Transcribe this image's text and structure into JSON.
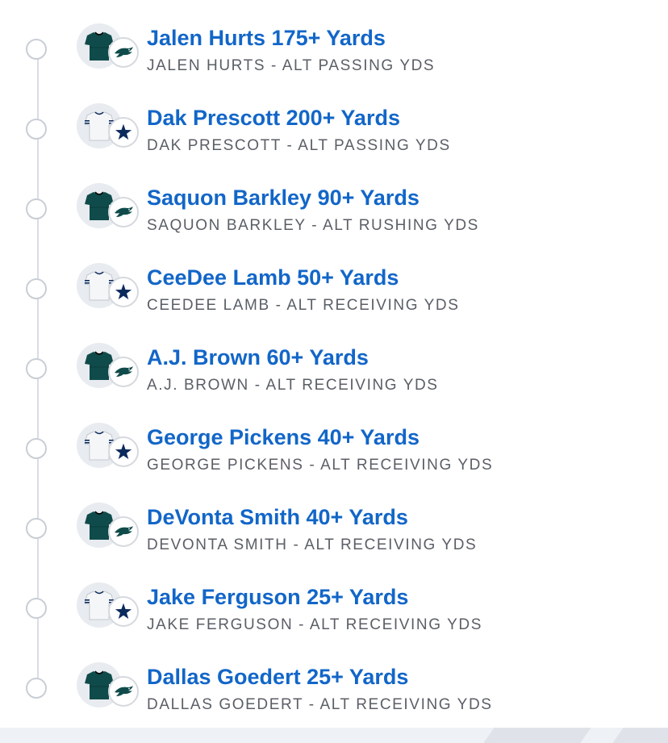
{
  "colors": {
    "title": "#1266c8",
    "subtitle": "#5a5f66",
    "eagles_green": "#0f4b4a",
    "cowboys_navy": "#0b2a5c",
    "timeline": "#c9ced6"
  },
  "legs": [
    {
      "title": "Jalen Hurts 175+ Yards",
      "subtitle": "JALEN HURTS - ALT PASSING YDS",
      "team": "eagles",
      "jersey_icon": "eagles-jersey-icon",
      "logo_icon": "eagles-logo-icon"
    },
    {
      "title": "Dak Prescott 200+ Yards",
      "subtitle": "DAK PRESCOTT - ALT PASSING YDS",
      "team": "cowboys",
      "jersey_icon": "cowboys-jersey-icon",
      "logo_icon": "cowboys-star-icon"
    },
    {
      "title": "Saquon Barkley 90+ Yards",
      "subtitle": "SAQUON BARKLEY - ALT RUSHING YDS",
      "team": "eagles",
      "jersey_icon": "eagles-jersey-icon",
      "logo_icon": "eagles-logo-icon"
    },
    {
      "title": "CeeDee Lamb 50+ Yards",
      "subtitle": "CEEDEE LAMB - ALT RECEIVING YDS",
      "team": "cowboys",
      "jersey_icon": "cowboys-jersey-icon",
      "logo_icon": "cowboys-star-icon"
    },
    {
      "title": "A.J. Brown 60+ Yards",
      "subtitle": "A.J. BROWN - ALT RECEIVING YDS",
      "team": "eagles",
      "jersey_icon": "eagles-jersey-icon",
      "logo_icon": "eagles-logo-icon"
    },
    {
      "title": "George Pickens 40+ Yards",
      "subtitle": "GEORGE PICKENS - ALT RECEIVING YDS",
      "team": "cowboys",
      "jersey_icon": "cowboys-jersey-icon",
      "logo_icon": "cowboys-star-icon"
    },
    {
      "title": "DeVonta Smith 40+ Yards",
      "subtitle": "DEVONTA SMITH - ALT RECEIVING YDS",
      "team": "eagles",
      "jersey_icon": "eagles-jersey-icon",
      "logo_icon": "eagles-logo-icon"
    },
    {
      "title": "Jake Ferguson 25+ Yards",
      "subtitle": "JAKE FERGUSON - ALT RECEIVING YDS",
      "team": "cowboys",
      "jersey_icon": "cowboys-jersey-icon",
      "logo_icon": "cowboys-star-icon"
    },
    {
      "title": "Dallas Goedert 25+ Yards",
      "subtitle": "DALLAS GOEDERT - ALT RECEIVING YDS",
      "team": "eagles",
      "jersey_icon": "eagles-jersey-icon",
      "logo_icon": "eagles-logo-icon"
    }
  ]
}
